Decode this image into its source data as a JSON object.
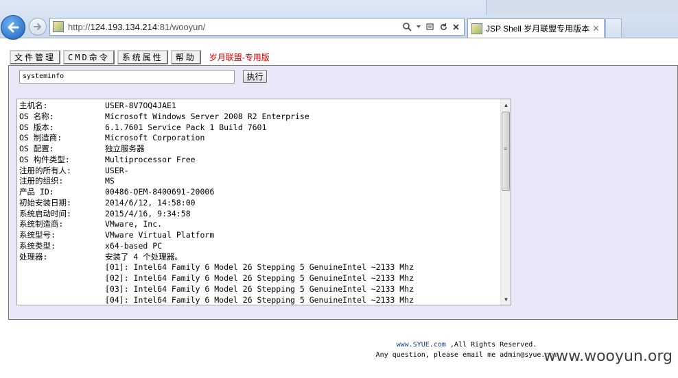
{
  "browser": {
    "url_prefix": "http://",
    "url_host": "124.193.134.214",
    "url_suffix": ":81/wooyun/",
    "tab_title": "JSP Shell 岁月联盟专用版本"
  },
  "menu": {
    "items": [
      "文件管理",
      "CMD命令",
      "系统属性",
      "帮助"
    ],
    "brand": "岁月联盟-专用版"
  },
  "command": {
    "input_value": "systeminfo",
    "execute_label": "执行"
  },
  "output": [
    {
      "k": "主机名:",
      "v": "USER-8V7OQ4JAE1"
    },
    {
      "k": "OS 名称:",
      "v": "Microsoft Windows Server 2008 R2 Enterprise"
    },
    {
      "k": "OS 版本:",
      "v": "6.1.7601 Service Pack 1 Build 7601"
    },
    {
      "k": "OS 制造商:",
      "v": "Microsoft Corporation"
    },
    {
      "k": "OS 配置:",
      "v": "独立服务器"
    },
    {
      "k": "OS 构件类型:",
      "v": "Multiprocessor Free"
    },
    {
      "k": "注册的所有人:",
      "v": "USER-"
    },
    {
      "k": "注册的组织:",
      "v": "MS"
    },
    {
      "k": "产品 ID:",
      "v": "00486-OEM-8400691-20006"
    },
    {
      "k": "初始安装日期:",
      "v": "2014/6/12, 14:58:00"
    },
    {
      "k": "系统启动时间:",
      "v": "2015/4/16, 9:34:58"
    },
    {
      "k": "系统制造商:",
      "v": "VMware, Inc."
    },
    {
      "k": "系统型号:",
      "v": "VMware Virtual Platform"
    },
    {
      "k": "系统类型:",
      "v": "x64-based PC"
    },
    {
      "k": "处理器:",
      "v": "安装了 4 个处理器。"
    },
    {
      "k": "",
      "v": "[01]: Intel64 Family 6 Model 26 Stepping 5 GenuineIntel ~2133 Mhz"
    },
    {
      "k": "",
      "v": "[02]: Intel64 Family 6 Model 26 Stepping 5 GenuineIntel ~2133 Mhz"
    },
    {
      "k": "",
      "v": "[03]: Intel64 Family 6 Model 26 Stepping 5 GenuineIntel ~2133 Mhz"
    },
    {
      "k": "",
      "v": "[04]: Intel64 Family 6 Model 26 Stepping 5 GenuineIntel ~2133 Mhz"
    }
  ],
  "footer": {
    "site_link": "www.SYUE.com",
    "rights": " ,All Rights Reserved.",
    "contact": "Any question, please email me admin@syue.com"
  },
  "watermark": "www.wooyun.org"
}
